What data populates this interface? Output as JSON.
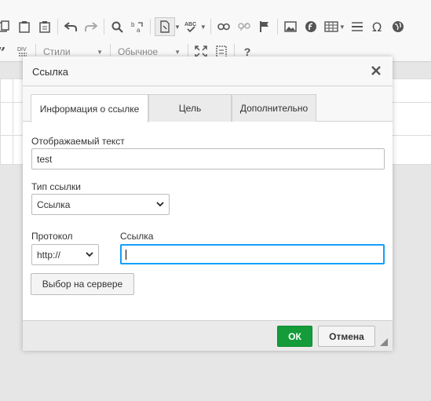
{
  "toolbar": {
    "styles_label": "Стили",
    "format_label": "Обычное",
    "div_label": "DIV",
    "help_label": "?"
  },
  "dialog": {
    "title": "Ссылка",
    "tabs": [
      {
        "label": "Информация о ссылке",
        "active": true
      },
      {
        "label": "Цель",
        "active": false
      },
      {
        "label": "Дополнительно",
        "active": false
      }
    ],
    "display_text": {
      "label": "Отображаемый текст",
      "value": "test"
    },
    "link_type": {
      "label": "Тип ссылки",
      "value": "Ссылка"
    },
    "protocol": {
      "label": "Протокол",
      "value": "http://"
    },
    "url": {
      "label": "Ссылка",
      "value": ""
    },
    "browse_server_label": "Выбор на сервере",
    "ok_label": "ОК",
    "cancel_label": "Отмена"
  },
  "colors": {
    "ok_green": "#149c3a",
    "focus_blue": "#139ff7"
  }
}
